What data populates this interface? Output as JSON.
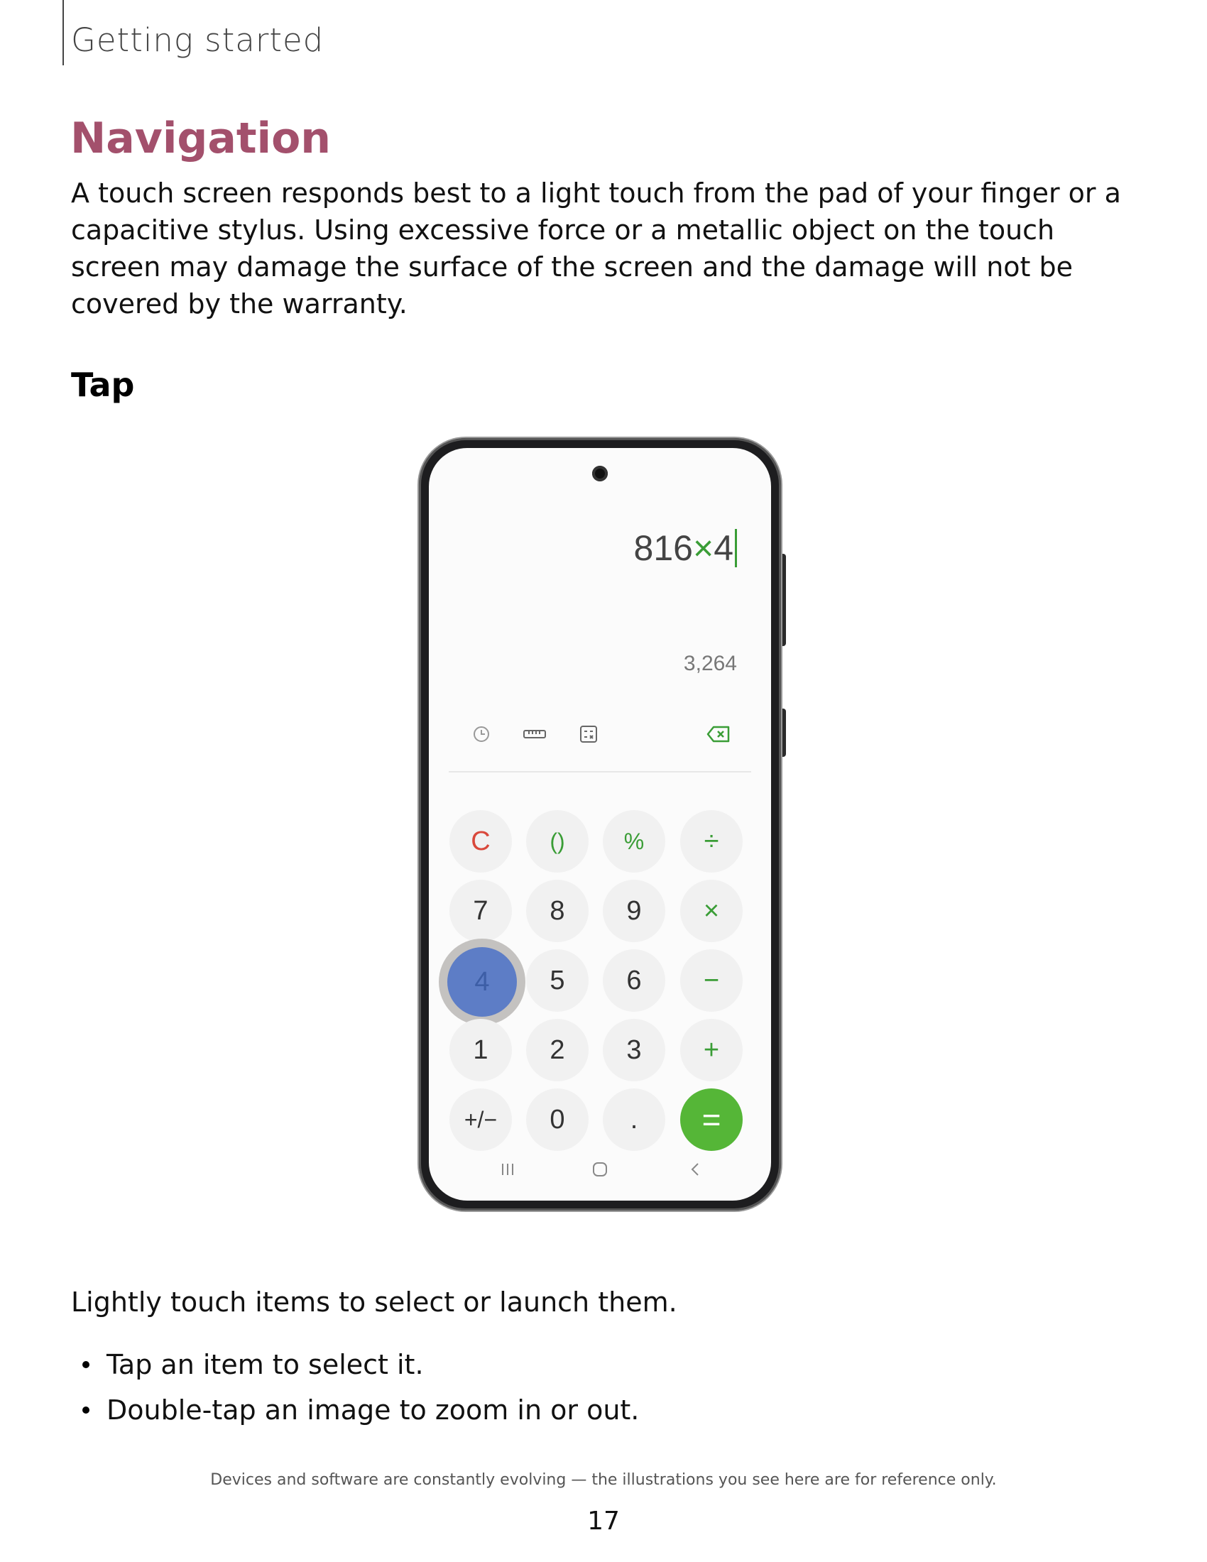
{
  "header": {
    "section": "Getting started"
  },
  "page": {
    "title": "Navigation",
    "intro": "A touch screen responds best to a light touch from the pad of your finger or a capacitive stylus. Using excessive force or a metallic object on the touch screen may damage the surface of the screen and the damage will not be covered by the warranty.",
    "subheading": "Tap",
    "lead": "Lightly touch items to select or launch them.",
    "bullets": [
      "Tap an item to select it.",
      "Double-tap an image to zoom in or out."
    ]
  },
  "calculator": {
    "expression_left": "816",
    "expression_op": "×",
    "expression_right": "4",
    "result": "3,264",
    "toolbar_icons": [
      "history-icon",
      "ruler-icon",
      "scientific-calculator-icon",
      "backspace-icon"
    ],
    "keys": {
      "clear": "C",
      "parens": "()",
      "percent": "%",
      "divide": "÷",
      "seven": "7",
      "eight": "8",
      "nine": "9",
      "multiply": "×",
      "four": "4",
      "five": "5",
      "six": "6",
      "minus": "−",
      "one": "1",
      "two": "2",
      "three": "3",
      "plus": "+",
      "plus_minus": "+/−",
      "zero": "0",
      "decimal": ".",
      "equals": "="
    },
    "pressed_key": "4",
    "nav_icons": [
      "recent-apps-icon",
      "home-icon",
      "back-icon"
    ],
    "colors": {
      "accent": "#55b637",
      "operator": "#3a9d36",
      "clear": "#d9483b",
      "touch": "#5d7dc6"
    }
  },
  "footer": {
    "disclaimer": "Devices and software are constantly evolving — the illustrations you see here are for reference only.",
    "page_number": "17"
  },
  "colors": {
    "title": "#a3506c"
  }
}
